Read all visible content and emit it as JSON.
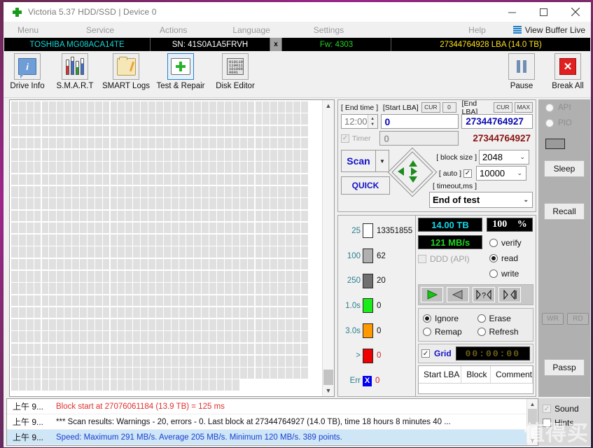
{
  "window": {
    "title": "Victoria 5.37 HDD/SSD | Device 0",
    "app_icon": "green-cross-icon",
    "minimize": "minimize-icon",
    "maximize": "maximize-icon",
    "close": "close-icon"
  },
  "menubar": {
    "items": [
      "Menu",
      "Service",
      "Actions",
      "Language",
      "Settings",
      "Help"
    ],
    "view_buffer_live": "View Buffer Live"
  },
  "drivebar": {
    "model": "TOSHIBA MG08ACA14TE",
    "serial": "SN: 41S0A1A5FRVH",
    "x_button": "x",
    "firmware": "Fw: 4303",
    "capacity": "27344764928 LBA (14.0 TB)"
  },
  "toolbar": {
    "buttons": [
      {
        "label": "Drive Info",
        "icon": "info-icon"
      },
      {
        "label": "S.M.A.R.T",
        "icon": "smart-bars-icon"
      },
      {
        "label": "SMART Logs",
        "icon": "folder-pencil-icon"
      },
      {
        "label": "Test & Repair",
        "icon": "first-aid-kit-icon"
      },
      {
        "label": "Disk Editor",
        "icon": "hex-page-icon"
      }
    ],
    "hex_glyph": "010110\n110011\n101000\n0001",
    "pause": {
      "label": "Pause",
      "icon": "pause-icon"
    },
    "break_all": {
      "label": "Break All",
      "icon": "red-x-icon"
    }
  },
  "scan_controls": {
    "end_time_label": "[ End time ]",
    "end_time_value": "12:00",
    "timer_label": "Timer",
    "timer_checked": true,
    "start_lba_label": "[Start LBA]",
    "start_lba_cur": "CUR",
    "start_lba_zero": "0",
    "start_lba_value": "0",
    "start_lba_second": "0",
    "end_lba_label": "[End LBA]",
    "end_lba_cur": "CUR",
    "end_lba_max": "MAX",
    "end_lba_value": "27344764927",
    "end_lba_second": "27344764927",
    "scan_button": "Scan",
    "scan_dropdown": "▼",
    "quick_button": "QUICK",
    "dpad": [
      "up-arrow-icon",
      "down-arrow-icon",
      "left-arrow-icon",
      "right-arrow-icon"
    ],
    "block_size_label": "[ block size ]",
    "block_size_value": "2048",
    "auto_label": "[ auto ]",
    "auto_checked": true,
    "timeout_label": "[ timeout,ms ]",
    "timeout_value": "10000",
    "end_of_test_value": "End of test"
  },
  "stats": {
    "rows": [
      {
        "label": "25",
        "color": "#ffffff",
        "value": "13351855"
      },
      {
        "label": "100",
        "color": "#b0b0b0",
        "value": "62"
      },
      {
        "label": "250",
        "color": "#707070",
        "value": "20"
      },
      {
        "label": "1.0s",
        "color": "#19ed19",
        "value": "0"
      },
      {
        "label": "3.0s",
        "color": "#ff9900",
        "value": "0"
      },
      {
        "label": ">",
        "color": "#ee0000",
        "value": "0"
      },
      {
        "label": "Err",
        "color": "#0000ee",
        "value": "0"
      }
    ],
    "err_glyph": "X"
  },
  "readout": {
    "capacity": "14.00 TB",
    "percent_value": "100",
    "percent_unit": "%",
    "speed": "121 MB/s",
    "ddd_label": "DDD (API)",
    "ddd_checked": false,
    "modes": [
      {
        "label": "verify",
        "selected": false
      },
      {
        "label": "read",
        "selected": true
      },
      {
        "label": "write",
        "selected": false
      }
    ],
    "media_buttons": [
      "play-icon",
      "rewind-icon",
      "step-question-icon",
      "skip-end-icon"
    ],
    "actions": [
      {
        "label": "Ignore",
        "selected": true
      },
      {
        "label": "Erase",
        "selected": false
      },
      {
        "label": "Remap",
        "selected": false
      },
      {
        "label": "Refresh",
        "selected": false
      }
    ],
    "grid_label": "Grid",
    "grid_checked": true,
    "timer_display": "00:00:00"
  },
  "results_table": {
    "columns": [
      "Start LBA",
      "Block",
      "Comment"
    ],
    "rows": []
  },
  "rail": {
    "api_label": "API",
    "pio_label": "PIO",
    "api_selected": true,
    "pio_selected": false,
    "sleep": "Sleep",
    "recall": "Recall",
    "wr": "WR",
    "rd": "RD",
    "passp": "Passp"
  },
  "log": {
    "entries": [
      {
        "time": "上午 9...",
        "message": "Block start at 27076061184 (13.9 TB)  = 125 ms",
        "color": "#e03030",
        "selected": false
      },
      {
        "time": "上午 9...",
        "message": "*** Scan results: Warnings - 20, errors - 0. Last block at 27344764927 (14.0 TB), time 18 hours 8 minutes 40 ...",
        "color": "#111111",
        "selected": false
      },
      {
        "time": "上午 9...",
        "message": "Speed: Maximum 291 MB/s. Average 205 MB/s. Minimum 120 MB/s. 389 points.",
        "color": "#1a3fd0",
        "selected": true
      }
    ],
    "sound_label": "Sound",
    "sound_checked": true,
    "hints_label": "Hints",
    "hints_checked": false
  },
  "watermark": "值得买"
}
